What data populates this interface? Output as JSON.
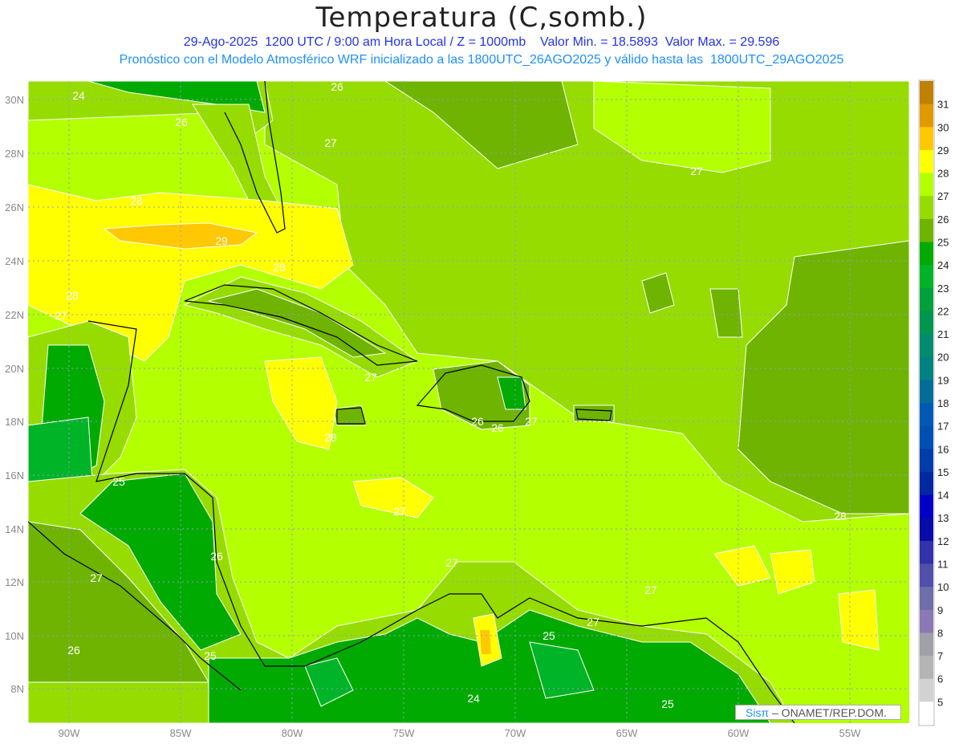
{
  "header": {
    "title": "Temperatura (C,somb.)",
    "subtitle_line1": "29-Ago-2025  1200 UTC / 9:00 am Hora Local / Z = 1000mb    Valor Min. = 18.5893  Valor Max. = 29.596",
    "subtitle_line2": "Pronóstico con el Modelo Atmosférico WRF inicializado a las 1800UTC_26AGO2025 y válido hasta las  1800UTC_29AGO2025"
  },
  "map": {
    "lon_labels": [
      "90W",
      "85W",
      "80W",
      "75W",
      "70W",
      "65W",
      "60W",
      "55W"
    ],
    "lat_labels": [
      "30N",
      "28N",
      "26N",
      "24N",
      "22N",
      "20N",
      "18N",
      "16N",
      "14N",
      "12N",
      "10N",
      "8N"
    ],
    "contour_labels": [
      "24",
      "26",
      "26",
      "27",
      "27",
      "28",
      "29",
      "28",
      "28",
      "27",
      "27",
      "28",
      "27",
      "26",
      "27",
      "25",
      "28",
      "26",
      "27",
      "27",
      "27",
      "27",
      "26",
      "25",
      "25",
      "24",
      "25",
      "26"
    ]
  },
  "colorbar": {
    "labels": [
      "31",
      "30",
      "29",
      "28",
      "27",
      "26",
      "25",
      "24",
      "23",
      "22",
      "21",
      "20",
      "19",
      "18",
      "17",
      "16",
      "15",
      "14",
      "13",
      "12",
      "11",
      "10",
      "9",
      "8",
      "7",
      "6",
      "5"
    ],
    "colors": [
      "#c08000",
      "#e09a00",
      "#ffc800",
      "#ffff00",
      "#b4ff00",
      "#96dc00",
      "#6eb400",
      "#00aa00",
      "#00b428",
      "#00a03c",
      "#009650",
      "#008c6e",
      "#008282",
      "#006e96",
      "#005ab4",
      "#0050b4",
      "#003caa",
      "#0028a0",
      "#0000c8",
      "#0a0aaa",
      "#3232aa",
      "#5050aa",
      "#6e6eaa",
      "#8c78b4",
      "#a0a0a8",
      "#b4b4b4",
      "#d2d2d2",
      "#ffffff"
    ]
  },
  "credit": {
    "brand": "Sisπ",
    "text": " – ONAMET/REP.DOM."
  }
}
